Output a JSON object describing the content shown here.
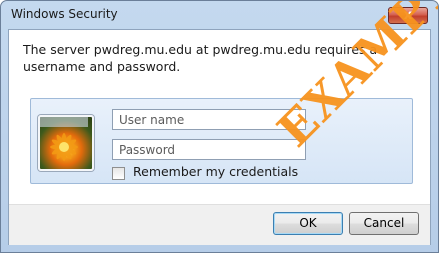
{
  "window": {
    "title": "Windows Security",
    "close_glyph": "x"
  },
  "message": "The server pwdreg.mu.edu at pwdreg.mu.edu requires a username and password.",
  "credentials": {
    "username_placeholder": "User name",
    "password_placeholder": "Password",
    "remember_label": "Remember my credentials",
    "remember_checked": false,
    "tile_icon": "user-tile-flower-icon"
  },
  "buttons": {
    "ok": "OK",
    "cancel": "Cancel"
  },
  "watermark": "EXAMPLE",
  "colors": {
    "watermark": "#f7931e",
    "titlebar": "#bfd5ee",
    "close_button": "#c9503f"
  }
}
